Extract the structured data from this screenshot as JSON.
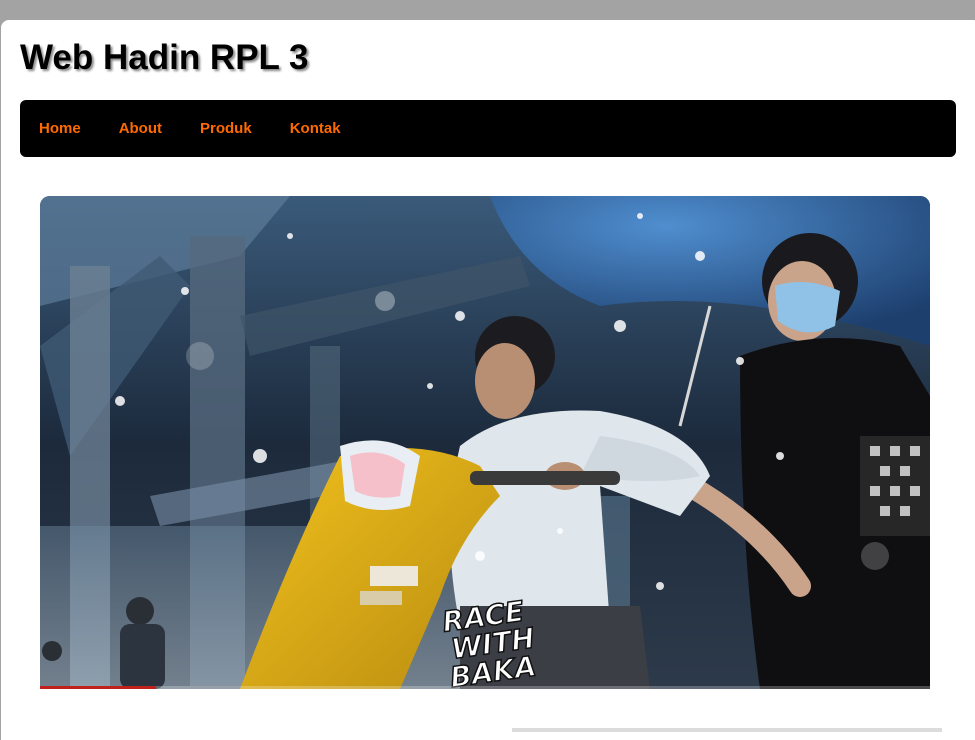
{
  "site": {
    "title": "Web Hadin RPL 3"
  },
  "nav": {
    "items": [
      {
        "label": "Home"
      },
      {
        "label": "About"
      },
      {
        "label": "Produk"
      },
      {
        "label": "Kontak"
      }
    ],
    "link_color": "#ff6a00"
  },
  "hero": {
    "overlay_text": [
      "RACE",
      "WITH",
      "BAKA"
    ],
    "progress_fraction": 0.13
  },
  "colors": {
    "background": "#a3a3a3",
    "page": "#ffffff",
    "navbar": "#000000",
    "progress": "#c0221b"
  }
}
